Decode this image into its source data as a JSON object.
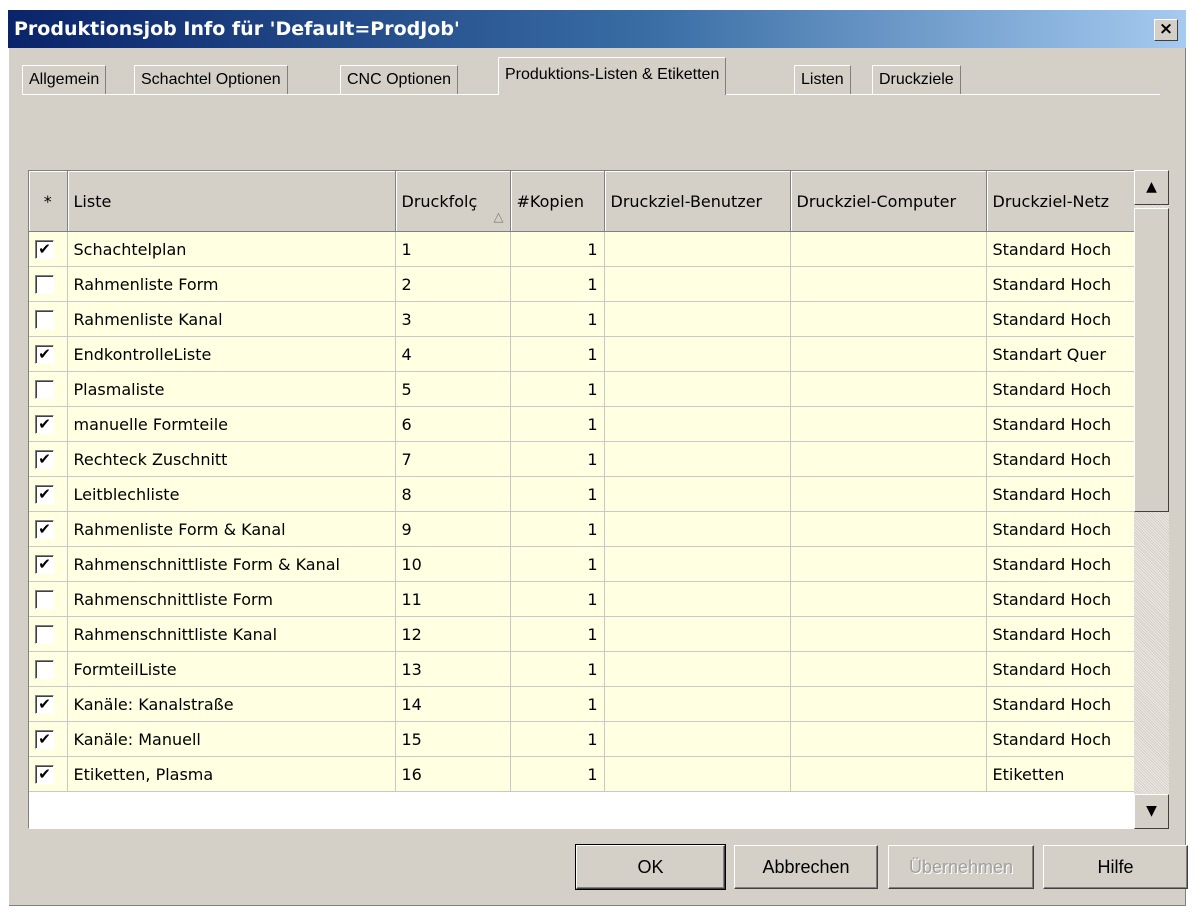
{
  "window": {
    "title": "Produktionsjob Info für 'Default=ProdJob'",
    "close_label": "×"
  },
  "tabs": [
    {
      "label": "Allgemein"
    },
    {
      "label": "Schachtel Optionen"
    },
    {
      "label": "CNC Optionen"
    },
    {
      "label": "Produktions-Listen & Etiketten"
    },
    {
      "label": "Listen"
    },
    {
      "label": "Druckziele"
    }
  ],
  "active_tab": "Produktions-Listen & Etiketten",
  "grid": {
    "columns": {
      "check": "*",
      "liste": "Liste",
      "druckfolge": "Druckfolç",
      "kopien": "#Kopien",
      "benutzer": "Druckziel-Benutzer",
      "computer": "Druckziel-Computer",
      "netz": "Druckziel-Netz"
    },
    "sort_icon": "△",
    "rows": [
      {
        "checked": true,
        "mark": "✔",
        "liste": "Schachtelplan",
        "druckfolge": "1",
        "kopien": "1",
        "benutzer": "",
        "computer": "",
        "netz": "Standard Hoch"
      },
      {
        "checked": false,
        "mark": "",
        "liste": "Rahmenliste Form",
        "druckfolge": "2",
        "kopien": "1",
        "benutzer": "",
        "computer": "",
        "netz": "Standard Hoch"
      },
      {
        "checked": false,
        "mark": "",
        "liste": "Rahmenliste Kanal",
        "druckfolge": "3",
        "kopien": "1",
        "benutzer": "",
        "computer": "",
        "netz": "Standard Hoch"
      },
      {
        "checked": true,
        "mark": "✔",
        "liste": "EndkontrolleListe",
        "druckfolge": "4",
        "kopien": "1",
        "benutzer": "",
        "computer": "",
        "netz": "Standart Quer"
      },
      {
        "checked": false,
        "mark": "",
        "liste": "Plasmaliste",
        "druckfolge": "5",
        "kopien": "1",
        "benutzer": "",
        "computer": "",
        "netz": "Standard Hoch"
      },
      {
        "checked": true,
        "mark": "✔",
        "liste": "manuelle Formteile",
        "druckfolge": "6",
        "kopien": "1",
        "benutzer": "",
        "computer": "",
        "netz": "Standard Hoch"
      },
      {
        "checked": true,
        "mark": "✔",
        "liste": "Rechteck Zuschnitt",
        "druckfolge": "7",
        "kopien": "1",
        "benutzer": "",
        "computer": "",
        "netz": "Standard Hoch"
      },
      {
        "checked": true,
        "mark": "✔",
        "liste": "Leitblechliste",
        "druckfolge": "8",
        "kopien": "1",
        "benutzer": "",
        "computer": "",
        "netz": "Standard Hoch"
      },
      {
        "checked": true,
        "mark": "✔",
        "liste": "Rahmenliste Form & Kanal",
        "druckfolge": "9",
        "kopien": "1",
        "benutzer": "",
        "computer": "",
        "netz": "Standard Hoch"
      },
      {
        "checked": true,
        "mark": "✔",
        "liste": "Rahmenschnittliste Form & Kanal",
        "druckfolge": "10",
        "kopien": "1",
        "benutzer": "",
        "computer": "",
        "netz": "Standard Hoch"
      },
      {
        "checked": false,
        "mark": "",
        "liste": "Rahmenschnittliste Form",
        "druckfolge": "11",
        "kopien": "1",
        "benutzer": "",
        "computer": "",
        "netz": "Standard Hoch"
      },
      {
        "checked": false,
        "mark": "",
        "liste": "Rahmenschnittliste Kanal",
        "druckfolge": "12",
        "kopien": "1",
        "benutzer": "",
        "computer": "",
        "netz": "Standard Hoch"
      },
      {
        "checked": false,
        "mark": "",
        "liste": "FormteilListe",
        "druckfolge": "13",
        "kopien": "1",
        "benutzer": "",
        "computer": "",
        "netz": "Standard Hoch"
      },
      {
        "checked": true,
        "mark": "✔",
        "liste": "Kanäle: Kanalstraße",
        "druckfolge": "14",
        "kopien": "1",
        "benutzer": "",
        "computer": "",
        "netz": "Standard Hoch"
      },
      {
        "checked": true,
        "mark": "✔",
        "liste": "Kanäle: Manuell",
        "druckfolge": "15",
        "kopien": "1",
        "benutzer": "",
        "computer": "",
        "netz": "Standard Hoch"
      },
      {
        "checked": true,
        "mark": "✔",
        "liste": "Etiketten, Plasma",
        "druckfolge": "16",
        "kopien": "1",
        "benutzer": "",
        "computer": "",
        "netz": "Etiketten"
      }
    ]
  },
  "scrollbar": {
    "up": "▲",
    "down": "▼"
  },
  "buttons": {
    "ok": "OK",
    "cancel": "Abbrechen",
    "apply": "Übernehmen",
    "help": "Hilfe"
  }
}
